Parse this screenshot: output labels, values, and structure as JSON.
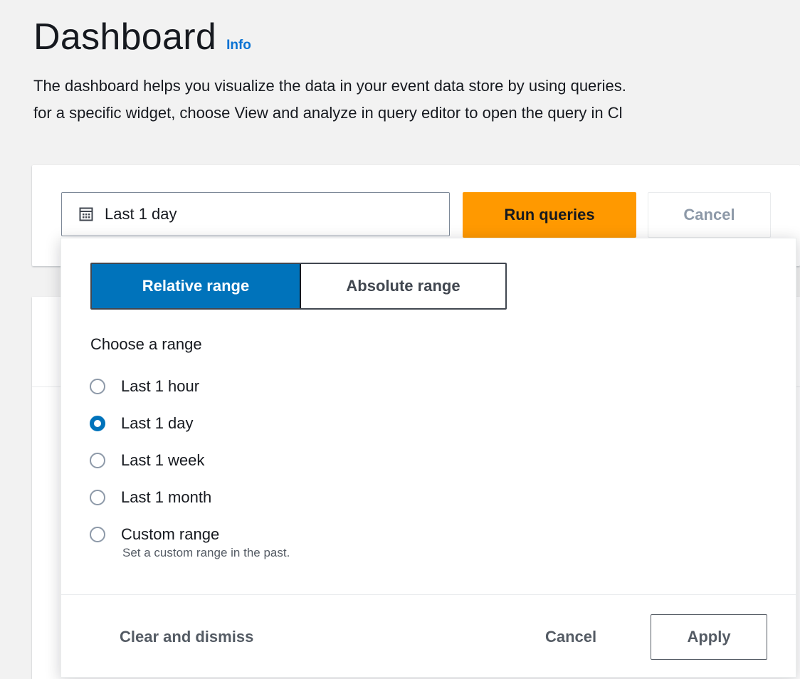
{
  "header": {
    "title": "Dashboard",
    "info_label": "Info",
    "description_line1": "The dashboard helps you visualize the data in your event data store by using queries.",
    "description_line2": "for a specific widget, choose View and analyze in query editor to open the query in Cl"
  },
  "toolbar": {
    "date_value": "Last 1 day",
    "calendar_icon": "calendar-icon",
    "run_label": "Run queries",
    "cancel_label": "Cancel"
  },
  "date_picker": {
    "tabs": [
      {
        "label": "Relative range",
        "active": true
      },
      {
        "label": "Absolute range",
        "active": false
      }
    ],
    "choose_label": "Choose a range",
    "options": [
      {
        "label": "Last 1 hour",
        "checked": false
      },
      {
        "label": "Last 1 day",
        "checked": true
      },
      {
        "label": "Last 1 week",
        "checked": false
      },
      {
        "label": "Last 1 month",
        "checked": false
      },
      {
        "label": "Custom range",
        "checked": false
      }
    ],
    "custom_description": "Set a custom range in the past.",
    "footer": {
      "clear_label": "Clear and dismiss",
      "cancel_label": "Cancel",
      "apply_label": "Apply"
    }
  },
  "colors": {
    "primary": "#ff9900",
    "selected": "#0073bb",
    "link": "#0972d3"
  }
}
